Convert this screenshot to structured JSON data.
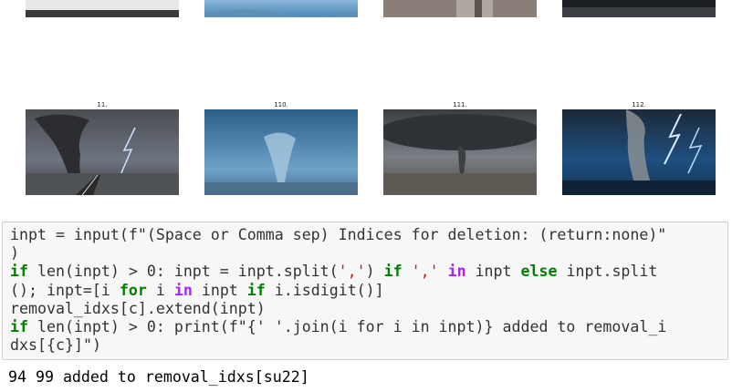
{
  "grid": {
    "top_row": [
      {
        "caption": ""
      },
      {
        "caption": ""
      },
      {
        "caption": ""
      },
      {
        "caption": ""
      }
    ],
    "bottom_row": [
      {
        "caption": "11."
      },
      {
        "caption": "110."
      },
      {
        "caption": "111."
      },
      {
        "caption": "112."
      }
    ]
  },
  "code": {
    "line1": "inpt = input(f\"(Space or Comma sep) Indices for deletion: (return:none)\"",
    "line2": ")",
    "line3a": "if",
    "line3b": " len(inpt) > 0: inpt = inpt.split(",
    "line3c": "','",
    "line3d": ") ",
    "line3e": "if",
    "line3f": " ",
    "line3g": "','",
    "line3h": " ",
    "line3i": "in",
    "line3j": " inpt ",
    "line3k": "else",
    "line3l": " inpt.split",
    "line4a": "(); inpt=[i ",
    "line4b": "for",
    "line4c": " i ",
    "line4d": "in",
    "line4e": " inpt ",
    "line4f": "if",
    "line4g": " i.isdigit()]",
    "line5": "removal_idxs[c].extend(inpt)",
    "line6a": "if",
    "line6b": " len(inpt) > 0: print(",
    "line6c": "f\"{' '.join(i for i in inpt)} added to removal_i",
    "line7a": "dxs[",
    "line7b": "{c}",
    "line7c": "]\"",
    "line7d": ")"
  },
  "output": {
    "text": "94 99 added to removal_idxs[su22]"
  }
}
